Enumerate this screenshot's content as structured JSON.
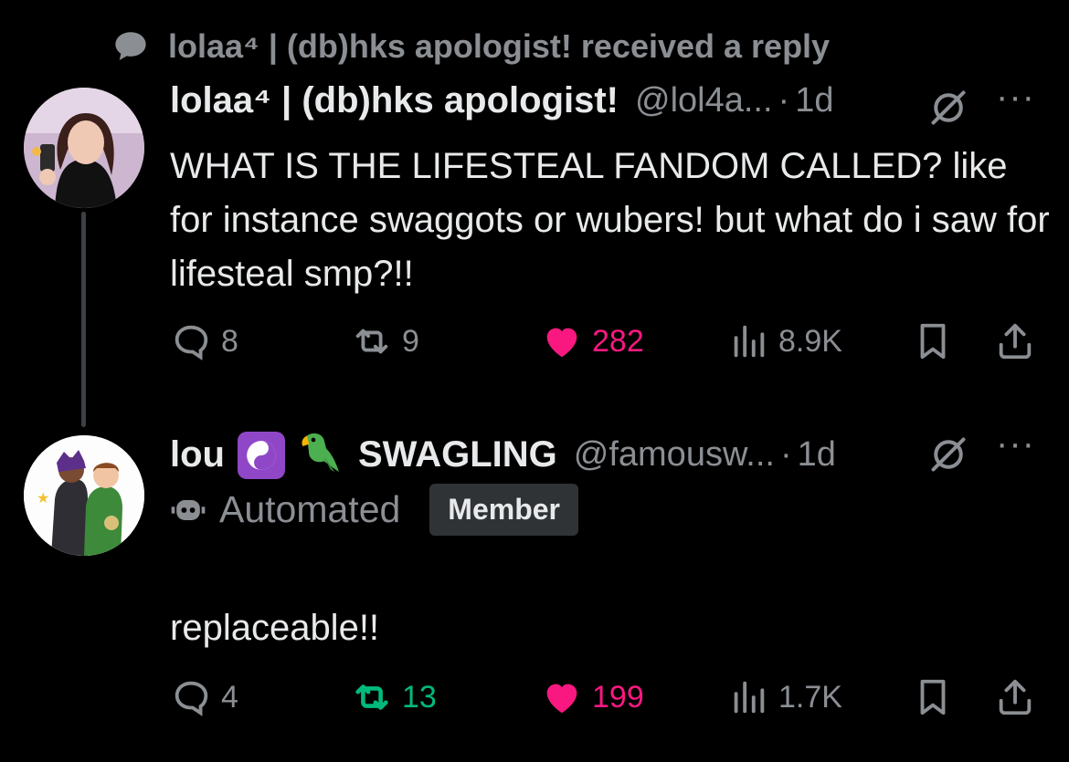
{
  "context": {
    "icon": "speech-bubble-icon",
    "text": "lolaa⁴ | (db)hks apologist! received a reply"
  },
  "posts": [
    {
      "name": "lolaa⁴ | (db)hks apologist!",
      "handle": "@lol4a...",
      "dot": "·",
      "time": "1d",
      "more": "···",
      "text": "WHAT IS THE LIFESTEAL FANDOM CALLED? like for instance swaggots or wubers! but what do i saw for lifesteal smp?!!",
      "replies": "8",
      "reposts": "9",
      "likes": "282",
      "views": "8.9K",
      "liked": true,
      "reposted": false
    },
    {
      "name": "lou",
      "emoji_badge": "☯",
      "emoji_parrot": "🦜",
      "name_suffix": "SWAGLING",
      "handle": "@famousw...",
      "dot": "·",
      "time": "1d",
      "more": "···",
      "automated_label": "Automated",
      "member_label": "Member",
      "text": "replaceable!!",
      "replies": "4",
      "reposts": "13",
      "likes": "199",
      "views": "1.7K",
      "liked": true,
      "reposted": true
    }
  ],
  "colors": {
    "background": "#000000",
    "text": "#e7e9ea",
    "muted": "#8b8f94",
    "like": "#f91880",
    "repost": "#00ba7c"
  }
}
